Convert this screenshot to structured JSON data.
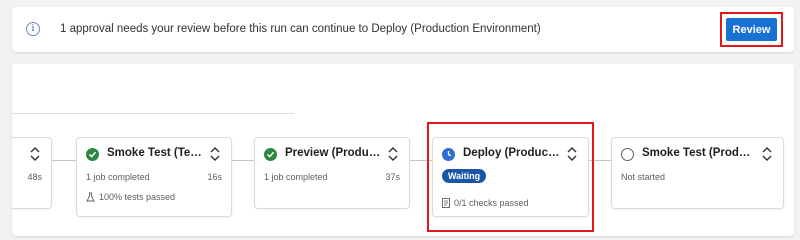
{
  "banner": {
    "message": "1 approval needs your review before this run can continue to Deploy (Production Environment)",
    "review_label": "Review",
    "info_icon": "info-icon"
  },
  "colors": {
    "accent": "#1871d3",
    "success": "#2e8640",
    "waiting_badge": "#1a55a6",
    "highlight": "#e3181b"
  },
  "stages": [
    {
      "title": "",
      "status": "success",
      "left_sub": "",
      "right_sub": "48s",
      "extra": ""
    },
    {
      "title": "Smoke Test (Test Envi...",
      "status": "success",
      "left_sub": "1 job completed",
      "right_sub": "16s",
      "extra": "100% tests passed",
      "extra_icon": "flask-icon"
    },
    {
      "title": "Preview (Production ...",
      "status": "success",
      "left_sub": "1 job completed",
      "right_sub": "37s",
      "extra": ""
    },
    {
      "title": "Deploy (Production E...",
      "status": "waiting",
      "badge": "Waiting",
      "extra": "0/1 checks passed",
      "extra_icon": "checklist-icon"
    },
    {
      "title": "Smoke Test (Producti...",
      "status": "not-started",
      "left_sub": "Not started",
      "right_sub": ""
    }
  ]
}
